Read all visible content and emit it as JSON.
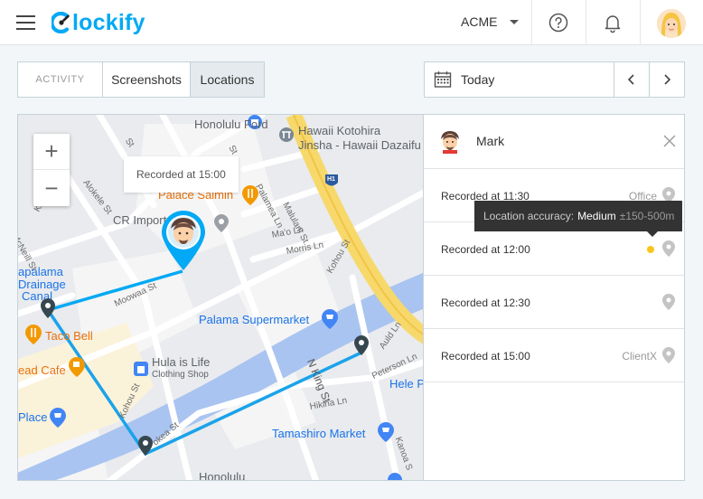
{
  "header": {
    "logo_text": "lockify",
    "workspace": "ACME",
    "icons": [
      "menu-icon",
      "help-icon",
      "bell-icon",
      "avatar"
    ]
  },
  "tabs": [
    {
      "label": "ACTIVITY",
      "active": false
    },
    {
      "label": "Screenshots",
      "active": false
    },
    {
      "label": "Locations",
      "active": true
    }
  ],
  "date_range": {
    "label": "Today"
  },
  "map": {
    "tooltip": "Recorded at 15:00",
    "zoom_in": "+",
    "zoom_out": "−",
    "labels": {
      "honolulu_ford": "Honolulu Ford",
      "hawaii_kotohira_1": "Hawaii Kotohira",
      "hawaii_kotohira_2": "Jinsha - Hawaii Dazaifu",
      "palace_saimin": "Palace Saimin",
      "cr_import": "CR Import",
      "kapalama_1": "apalama",
      "kapalama_2": "Drainage",
      "kapalama_3": "Canal",
      "taco_bell": "Taco Bell",
      "palama_supermarket": "Palama Supermarket",
      "hula_1": "Hula is Life",
      "hula_2": "Clothing Shop",
      "bread_cafe": "ead Cafe",
      "place": "Place",
      "tamashiro": "Tamashiro Market",
      "honolulu_bottom": "Honolulu",
      "hele": "Hele P",
      "n_king_st": "N King St",
      "h1": "H1"
    },
    "streets": {
      "alokele": "Alokele St",
      "kalani": "Kal",
      "mcneill": "McNeill St",
      "palamea": "Palamea Ln",
      "malulani": "Malulani St",
      "maolo": "Ma'o Ln",
      "morris": "Morris Ln",
      "kohou": "Kohou St",
      "moowaa": "Moowaa St",
      "kokea": "Kokea St",
      "kohou2": "Kohou St",
      "okea": "okea St",
      "peterson": "Peterson Ln",
      "auld": "Auld Ln",
      "hikina": "Hikina Ln",
      "kanoa": "Kanoa S",
      "liliha": "ll St",
      "st1": "St",
      "st2": "St"
    }
  },
  "panel": {
    "user": "Mark",
    "entries": [
      {
        "time": "Recorded at 11:30",
        "place": "Office"
      },
      {
        "time": "Recorded at 12:00",
        "place": ""
      },
      {
        "time": "Recorded at 12:30",
        "place": ""
      },
      {
        "time": "Recorded at 15:00",
        "place": "ClientX"
      }
    ],
    "accuracy_tooltip": {
      "prefix": "Location accuracy:",
      "level": "Medium",
      "range": "±150-500m"
    }
  },
  "colors": {
    "brand": "#03a9f4",
    "route": "#1aa3ea",
    "accuracy_dot": "#f9c51b"
  }
}
